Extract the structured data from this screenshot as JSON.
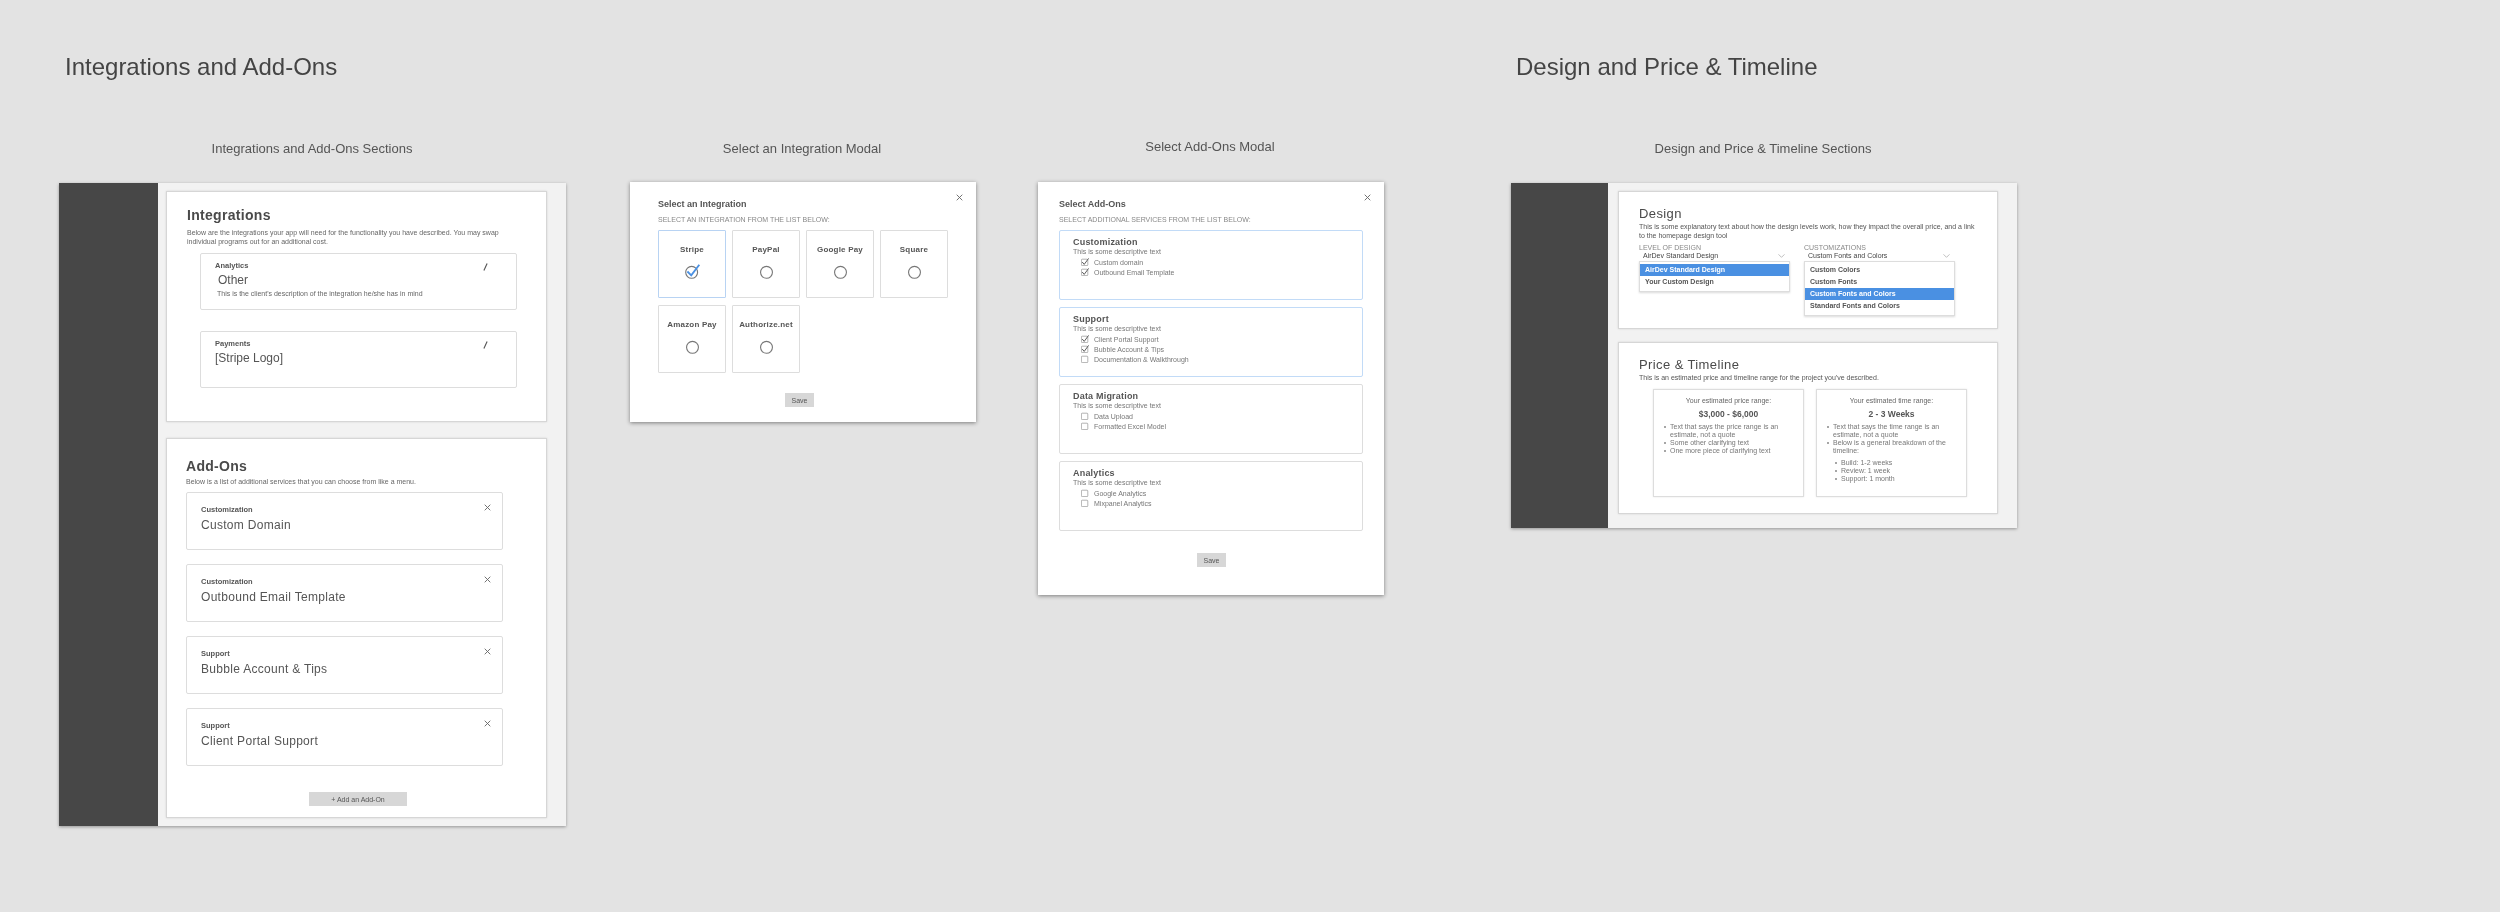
{
  "headings": [
    "Integrations and Add-Ons",
    "Design and Price & Timeline"
  ],
  "integrations_artboard": {
    "label": "Integrations and Add-Ons Sections",
    "integrations": {
      "title": "Integrations",
      "description": "Below are the integrations your app will need for the functionality you have described. You may swap individual programs out for an additional cost.",
      "items": [
        {
          "category": "Analytics",
          "name": "Other",
          "description": "This is the client's description of the integration he/she has in mind"
        },
        {
          "category": "Payments",
          "name": "[Stripe Logo]"
        }
      ]
    },
    "add_ons": {
      "title": "Add-Ons",
      "description": "Below is a list of additional services that you can choose from like a menu.",
      "items": [
        {
          "category": "Customization",
          "name": "Custom Domain"
        },
        {
          "category": "Customization",
          "name": "Outbound Email Template"
        },
        {
          "category": "Support",
          "name": "Bubble Account & Tips"
        },
        {
          "category": "Support",
          "name": "Client Portal Support"
        }
      ],
      "add_button": "+ Add an Add-On"
    }
  },
  "integration_modal": {
    "label": "Select an Integration Modal",
    "title": "Select an Integration",
    "subtitle": "SELECT AN INTEGRATION FROM THE LIST BELOW:",
    "options": [
      {
        "name": "Stripe",
        "selected": true
      },
      {
        "name": "PayPal",
        "selected": false
      },
      {
        "name": "Google Pay",
        "selected": false
      },
      {
        "name": "Square",
        "selected": false
      },
      {
        "name": "Amazon Pay",
        "selected": false
      },
      {
        "name": "Authorize.net",
        "selected": false
      }
    ],
    "save_button": "Save"
  },
  "addons_modal": {
    "label": "Select Add-Ons Modal",
    "title": "Select Add-Ons",
    "subtitle": "SELECT ADDITIONAL SERVICES FROM THE LIST BELOW:",
    "groups": [
      {
        "title": "Customization",
        "description": "This is some descriptive text",
        "items": [
          {
            "label": "Custom domain",
            "checked": true
          },
          {
            "label": "Outbound Email Template",
            "checked": true
          }
        ]
      },
      {
        "title": "Support",
        "description": "This is some descriptive text",
        "items": [
          {
            "label": "Client Portal Support",
            "checked": true
          },
          {
            "label": "Bubble Account & Tips",
            "checked": true
          },
          {
            "label": "Documentation & Walkthrough",
            "checked": false
          }
        ]
      },
      {
        "title": "Data Migration",
        "description": "This is some descriptive text",
        "items": [
          {
            "label": "Data Upload",
            "checked": false
          },
          {
            "label": "Formatted Excel Model",
            "checked": false
          }
        ]
      },
      {
        "title": "Analytics",
        "description": "This is some descriptive text",
        "items": [
          {
            "label": "Google Analytics",
            "checked": false
          },
          {
            "label": "Mixpanel Analytics",
            "checked": false
          }
        ]
      }
    ],
    "save_button": "Save"
  },
  "design_artboard": {
    "label": "Design and Price & Timeline Sections",
    "design": {
      "title": "Design",
      "description": "This is some explanatory text about how the design levels work, how they impact the overall price, and a link to the homepage design tool",
      "dropdowns": [
        {
          "label": "LEVEL OF DESIGN",
          "value": "AirDev Standard Design",
          "options": [
            {
              "label": "AirDev Standard Design",
              "selected": true
            },
            {
              "label": "Your Custom Design",
              "selected": false
            }
          ]
        },
        {
          "label": "CUSTOMIZATIONS",
          "value": "Custom Fonts and Colors",
          "options": [
            {
              "label": "Custom Colors",
              "selected": false
            },
            {
              "label": "Custom Fonts",
              "selected": false
            },
            {
              "label": "Custom Fonts and Colors",
              "selected": true
            },
            {
              "label": "Standard Fonts and Colors",
              "selected": false
            }
          ]
        }
      ]
    },
    "price_timeline": {
      "title": "Price & Timeline",
      "description": "This is an estimated price and timeline range for the project you've described.",
      "estimates": [
        {
          "caption": "Your estimated price range:",
          "value": "$3,000 - $6,000",
          "notes": [
            {
              "text": "Text that says the price range is an estimate, not a quote"
            },
            {
              "text": "Some other clarifying text"
            },
            {
              "text": "One more piece of clarifying text"
            }
          ]
        },
        {
          "caption": "Your estimated time range:",
          "value": "2 - 3 Weeks",
          "notes": [
            {
              "text": "Text that says the time range is an estimate, not a quote"
            },
            {
              "text": "Below is a general breakdown of the timeline:",
              "children": [
                {
                  "text": "Build: 1-2 weeks"
                },
                {
                  "text": "Review: 1 week"
                },
                {
                  "text": "Support: 1 month"
                }
              ]
            }
          ]
        }
      ]
    }
  }
}
